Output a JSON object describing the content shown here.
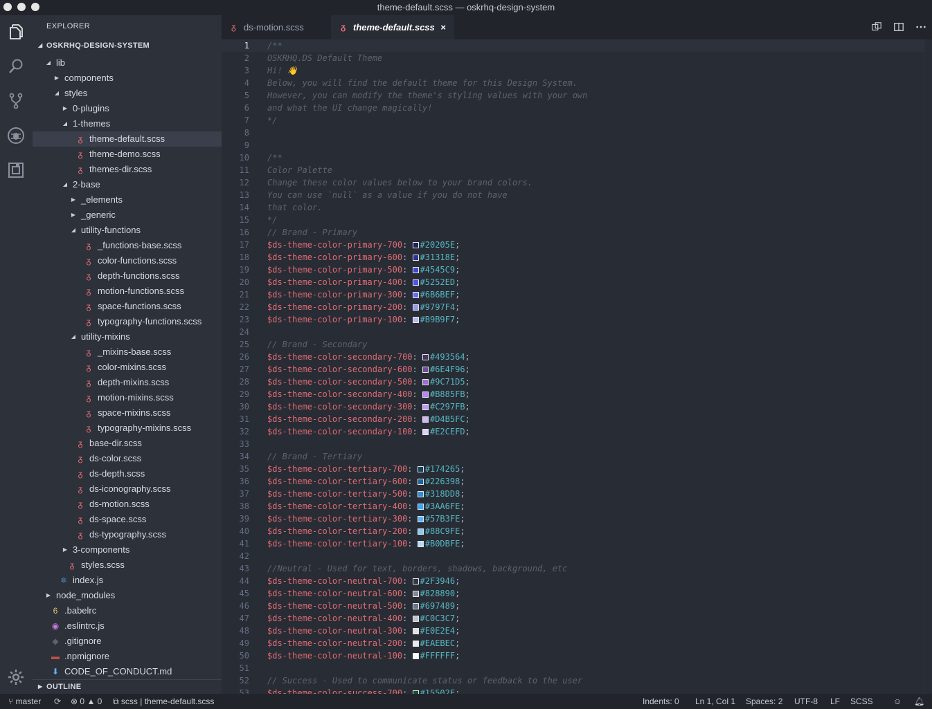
{
  "window": {
    "title": "theme-default.scss — oskrhq-design-system"
  },
  "activity": {
    "icons": [
      "explorer-icon",
      "search-icon",
      "source-control-icon",
      "debug-icon",
      "extensions-icon",
      "settings-gear-icon"
    ]
  },
  "sidebar": {
    "title": "EXPLORER",
    "project": "OSKRHQ-DESIGN-SYSTEM",
    "outline": "OUTLINE",
    "tree": [
      {
        "label": "lib",
        "depth": 0,
        "type": "folder",
        "open": true
      },
      {
        "label": "components",
        "depth": 1,
        "type": "folder",
        "open": false
      },
      {
        "label": "styles",
        "depth": 1,
        "type": "folder",
        "open": true
      },
      {
        "label": "0-plugins",
        "depth": 2,
        "type": "folder",
        "open": false
      },
      {
        "label": "1-themes",
        "depth": 2,
        "type": "folder",
        "open": true
      },
      {
        "label": "theme-default.scss",
        "depth": 3,
        "type": "scss",
        "active": true
      },
      {
        "label": "theme-demo.scss",
        "depth": 3,
        "type": "scss"
      },
      {
        "label": "themes-dir.scss",
        "depth": 3,
        "type": "scss"
      },
      {
        "label": "2-base",
        "depth": 2,
        "type": "folder",
        "open": true
      },
      {
        "label": "_elements",
        "depth": 3,
        "type": "folder",
        "open": false
      },
      {
        "label": "_generic",
        "depth": 3,
        "type": "folder",
        "open": false
      },
      {
        "label": "utility-functions",
        "depth": 3,
        "type": "folder",
        "open": true
      },
      {
        "label": "_functions-base.scss",
        "depth": 4,
        "type": "scss"
      },
      {
        "label": "color-functions.scss",
        "depth": 4,
        "type": "scss"
      },
      {
        "label": "depth-functions.scss",
        "depth": 4,
        "type": "scss"
      },
      {
        "label": "motion-functions.scss",
        "depth": 4,
        "type": "scss"
      },
      {
        "label": "space-functions.scss",
        "depth": 4,
        "type": "scss"
      },
      {
        "label": "typography-functions.scss",
        "depth": 4,
        "type": "scss"
      },
      {
        "label": "utility-mixins",
        "depth": 3,
        "type": "folder",
        "open": true
      },
      {
        "label": "_mixins-base.scss",
        "depth": 4,
        "type": "scss"
      },
      {
        "label": "color-mixins.scss",
        "depth": 4,
        "type": "scss"
      },
      {
        "label": "depth-mixins.scss",
        "depth": 4,
        "type": "scss"
      },
      {
        "label": "motion-mixins.scss",
        "depth": 4,
        "type": "scss"
      },
      {
        "label": "space-mixins.scss",
        "depth": 4,
        "type": "scss"
      },
      {
        "label": "typography-mixins.scss",
        "depth": 4,
        "type": "scss"
      },
      {
        "label": "base-dir.scss",
        "depth": 3,
        "type": "scss"
      },
      {
        "label": "ds-color.scss",
        "depth": 3,
        "type": "scss"
      },
      {
        "label": "ds-depth.scss",
        "depth": 3,
        "type": "scss"
      },
      {
        "label": "ds-iconography.scss",
        "depth": 3,
        "type": "scss"
      },
      {
        "label": "ds-motion.scss",
        "depth": 3,
        "type": "scss"
      },
      {
        "label": "ds-space.scss",
        "depth": 3,
        "type": "scss"
      },
      {
        "label": "ds-typography.scss",
        "depth": 3,
        "type": "scss"
      },
      {
        "label": "3-components",
        "depth": 2,
        "type": "folder",
        "open": false
      },
      {
        "label": "styles.scss",
        "depth": 2,
        "type": "scss"
      },
      {
        "label": "index.js",
        "depth": 1,
        "type": "react"
      },
      {
        "label": "node_modules",
        "depth": 0,
        "type": "folder",
        "open": false
      },
      {
        "label": ".babelrc",
        "depth": 0,
        "type": "babel"
      },
      {
        "label": ".eslintrc.js",
        "depth": 0,
        "type": "eslint"
      },
      {
        "label": ".gitignore",
        "depth": 0,
        "type": "git"
      },
      {
        "label": ".npmignore",
        "depth": 0,
        "type": "npm"
      },
      {
        "label": "CODE_OF_CONDUCT.md",
        "depth": 0,
        "type": "md"
      }
    ]
  },
  "tabs": [
    {
      "label": "ds-motion.scss",
      "active": false
    },
    {
      "label": "theme-default.scss",
      "active": true,
      "close": "×"
    }
  ],
  "editor": {
    "current_line": 1,
    "lines": [
      [
        [
          "c",
          "/**"
        ]
      ],
      [
        [
          "c",
          "OSKRHQ.DS Default Theme"
        ]
      ],
      [
        [
          "c",
          "Hi! 👋"
        ]
      ],
      [
        [
          "c",
          "Below, you will find the default theme for this Design System."
        ]
      ],
      [
        [
          "c",
          "However, you can modify the theme's styling values with your own"
        ]
      ],
      [
        [
          "c",
          "and what the UI change magically!"
        ]
      ],
      [
        [
          "c",
          "*/"
        ]
      ],
      [],
      [],
      [
        [
          "c",
          "/**"
        ]
      ],
      [
        [
          "c",
          "Color Palette"
        ]
      ],
      [
        [
          "c",
          "Change these color values below to your brand colors."
        ]
      ],
      [
        [
          "c",
          "You can use `null` as a value if you do not have"
        ]
      ],
      [
        [
          "c",
          "that color."
        ]
      ],
      [
        [
          "c",
          "*/"
        ]
      ],
      [
        [
          "c",
          "// Brand - Primary"
        ]
      ],
      [
        [
          "v",
          "$ds-theme-color-primary-700"
        ],
        [
          "h",
          "#20205E"
        ]
      ],
      [
        [
          "v",
          "$ds-theme-color-primary-600"
        ],
        [
          "h",
          "#31318E"
        ]
      ],
      [
        [
          "v",
          "$ds-theme-color-primary-500"
        ],
        [
          "h",
          "#4545C9"
        ]
      ],
      [
        [
          "v",
          "$ds-theme-color-primary-400"
        ],
        [
          "h",
          "#5252ED"
        ]
      ],
      [
        [
          "v",
          "$ds-theme-color-primary-300"
        ],
        [
          "h",
          "#6B6BEF"
        ]
      ],
      [
        [
          "v",
          "$ds-theme-color-primary-200"
        ],
        [
          "h",
          "#9797F4"
        ]
      ],
      [
        [
          "v",
          "$ds-theme-color-primary-100"
        ],
        [
          "h",
          "#B9B9F7"
        ]
      ],
      [],
      [
        [
          "c",
          "// Brand - Secondary"
        ]
      ],
      [
        [
          "v",
          "$ds-theme-color-secondary-700"
        ],
        [
          "h",
          "#493564"
        ]
      ],
      [
        [
          "v",
          "$ds-theme-color-secondary-600"
        ],
        [
          "h",
          "#6E4F96"
        ]
      ],
      [
        [
          "v",
          "$ds-theme-color-secondary-500"
        ],
        [
          "h",
          "#9C71D5"
        ]
      ],
      [
        [
          "v",
          "$ds-theme-color-secondary-400"
        ],
        [
          "h",
          "#B885FB"
        ]
      ],
      [
        [
          "v",
          "$ds-theme-color-secondary-300"
        ],
        [
          "h",
          "#C297FB"
        ]
      ],
      [
        [
          "v",
          "$ds-theme-color-secondary-200"
        ],
        [
          "h",
          "#D4B5FC"
        ]
      ],
      [
        [
          "v",
          "$ds-theme-color-secondary-100"
        ],
        [
          "h",
          "#E2CEFD"
        ]
      ],
      [],
      [
        [
          "c",
          "// Brand - Tertiary"
        ]
      ],
      [
        [
          "v",
          "$ds-theme-color-tertiary-700"
        ],
        [
          "h",
          "#174265"
        ]
      ],
      [
        [
          "v",
          "$ds-theme-color-tertiary-600"
        ],
        [
          "h",
          "#226398"
        ]
      ],
      [
        [
          "v",
          "$ds-theme-color-tertiary-500"
        ],
        [
          "h",
          "#318DD8"
        ]
      ],
      [
        [
          "v",
          "$ds-theme-color-tertiary-400"
        ],
        [
          "h",
          "#3AA6FE"
        ]
      ],
      [
        [
          "v",
          "$ds-theme-color-tertiary-300"
        ],
        [
          "h",
          "#57B3FE"
        ]
      ],
      [
        [
          "v",
          "$ds-theme-color-tertiary-200"
        ],
        [
          "h",
          "#88C9FE"
        ]
      ],
      [
        [
          "v",
          "$ds-theme-color-tertiary-100"
        ],
        [
          "h",
          "#B0DBFE"
        ]
      ],
      [],
      [
        [
          "c",
          "//Neutral - Used for text, borders, shadows, background, etc"
        ]
      ],
      [
        [
          "v",
          "$ds-theme-color-neutral-700"
        ],
        [
          "h",
          "#2F3946"
        ]
      ],
      [
        [
          "v",
          "$ds-theme-color-neutral-600"
        ],
        [
          "h",
          "#828890"
        ]
      ],
      [
        [
          "v",
          "$ds-theme-color-neutral-500"
        ],
        [
          "h",
          "#697489"
        ]
      ],
      [
        [
          "v",
          "$ds-theme-color-neutral-400"
        ],
        [
          "h",
          "#C0C3C7"
        ]
      ],
      [
        [
          "v",
          "$ds-theme-color-neutral-300"
        ],
        [
          "h",
          "#E0E2E4"
        ]
      ],
      [
        [
          "v",
          "$ds-theme-color-neutral-200"
        ],
        [
          "h",
          "#EAEBEC"
        ]
      ],
      [
        [
          "v",
          "$ds-theme-color-neutral-100"
        ],
        [
          "h",
          "#FFFFFF"
        ]
      ],
      [],
      [
        [
          "c",
          "// Success - Used to communicate status or feedback to the user"
        ]
      ],
      [
        [
          "v",
          "$ds-theme-color-success-700"
        ],
        [
          "h",
          "#15502E"
        ]
      ]
    ]
  },
  "statusbar": {
    "branch": "master",
    "errors": "0",
    "warnings": "0",
    "breadcrumb": "scss | theme-default.scss",
    "indents": "Indents: 0",
    "position": "Ln 1, Col 1",
    "spaces": "Spaces: 2",
    "encoding": "UTF-8",
    "eol": "LF",
    "language": "SCSS"
  },
  "colors": {
    "accent_scss": "#f07178",
    "variable": "#e06c75",
    "hex": "#56b6c2",
    "comment": "#5c6370"
  }
}
